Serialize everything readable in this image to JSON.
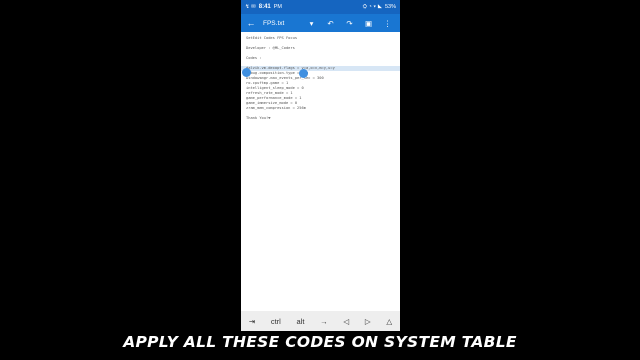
{
  "status": {
    "time": "8:41",
    "ampm": "PM",
    "battery": "53%",
    "left_icons": "↯ ✉",
    "right_icons": "⛭ ◔ ▾ ◣"
  },
  "appbar": {
    "back_icon": "back-arrow-icon",
    "title": "FPS.txt",
    "dropdown": "▾",
    "undo": "↶",
    "redo": "↷",
    "save": "▣",
    "more": "⋮"
  },
  "editor": {
    "lines": [
      "SetEdit Codes FPS Focus",
      "",
      "Developer : @ML_Coders",
      "",
      "Codes :",
      "",
      "dalvik.vm.dexopt-flags = v=a,o=v,m=y,u=y",
      "debug.composition.type = gpu",
      "windowsmgr.max_events_per_sec = 300",
      "ro.cpuftmp.game = 1",
      "intelligent_sleep_mode = 0",
      "refresh_rate_mode = 1",
      "game_performance_mode = 1",
      "game_immersive_mode = 0",
      "zram_mem_compression = 256m",
      "",
      "Thank You!❤"
    ]
  },
  "keybar": {
    "keys": [
      "⇥",
      "ctrl",
      "alt",
      "→",
      "◁",
      "▷",
      "△"
    ]
  },
  "caption": "APPLY ALL THESE CODES ON SYSTEM TABLE"
}
